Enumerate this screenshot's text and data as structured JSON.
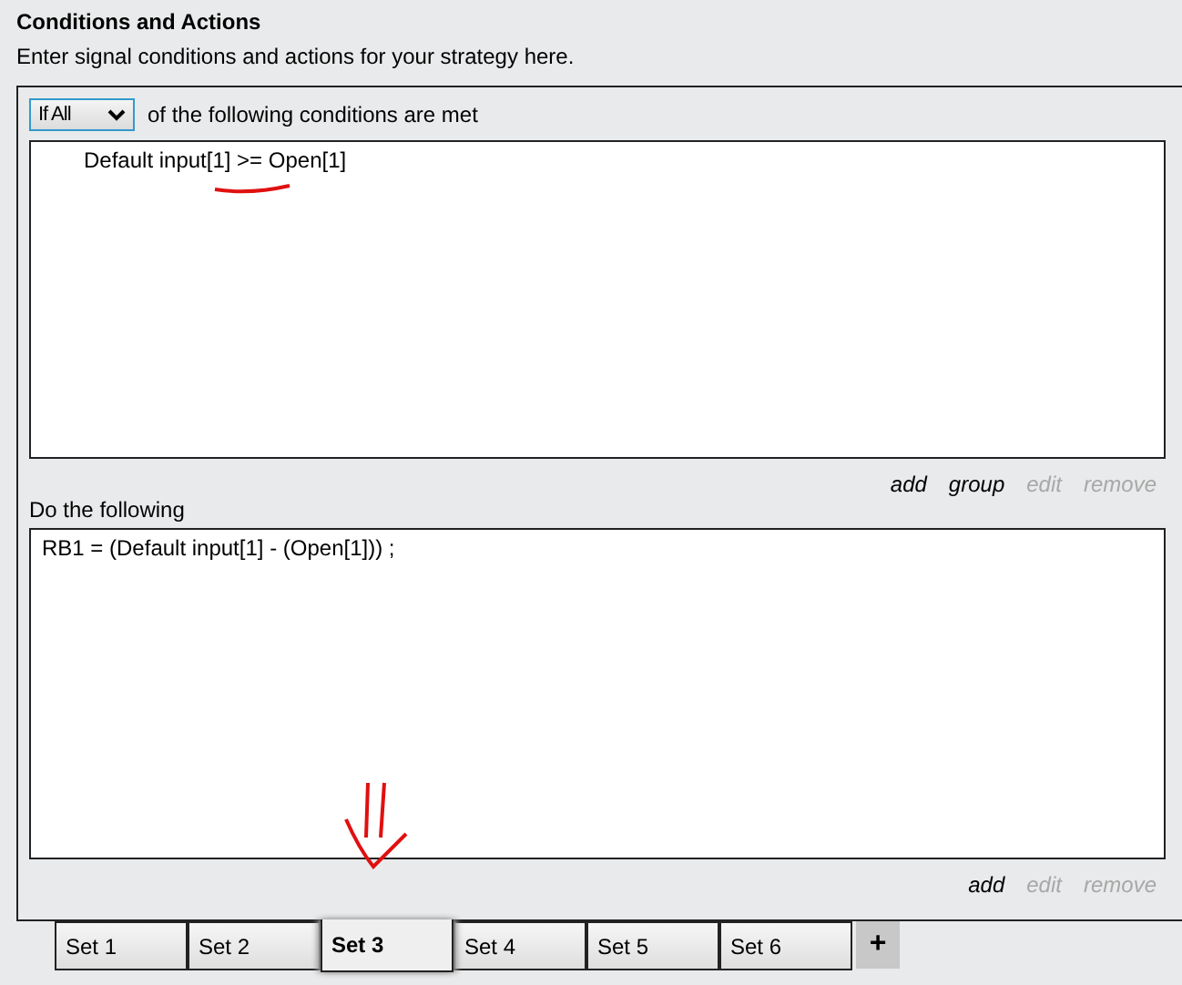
{
  "header": {
    "title": "Conditions and Actions",
    "subtitle": "Enter signal conditions and actions for your strategy here."
  },
  "conditions": {
    "mode": "If All",
    "mode_suffix": "of the following conditions are met",
    "items": [
      "Default input[1] >= Open[1]"
    ],
    "links": [
      {
        "label": "add",
        "disabled": false
      },
      {
        "label": "group",
        "disabled": false
      },
      {
        "label": "edit",
        "disabled": true
      },
      {
        "label": "remove",
        "disabled": true
      }
    ]
  },
  "actions": {
    "label": "Do the following",
    "items": [
      "RB1 = (Default input[1] - (Open[1])) ;"
    ],
    "links": [
      {
        "label": "add",
        "disabled": false
      },
      {
        "label": "edit",
        "disabled": true
      },
      {
        "label": "remove",
        "disabled": true
      }
    ]
  },
  "tabs": [
    {
      "label": "Set 1",
      "selected": false
    },
    {
      "label": "Set 2",
      "selected": false
    },
    {
      "label": "Set 3",
      "selected": true
    },
    {
      "label": "Set 4",
      "selected": false
    },
    {
      "label": "Set 5",
      "selected": false
    },
    {
      "label": "Set 6",
      "selected": false
    }
  ],
  "add_tab": "+"
}
